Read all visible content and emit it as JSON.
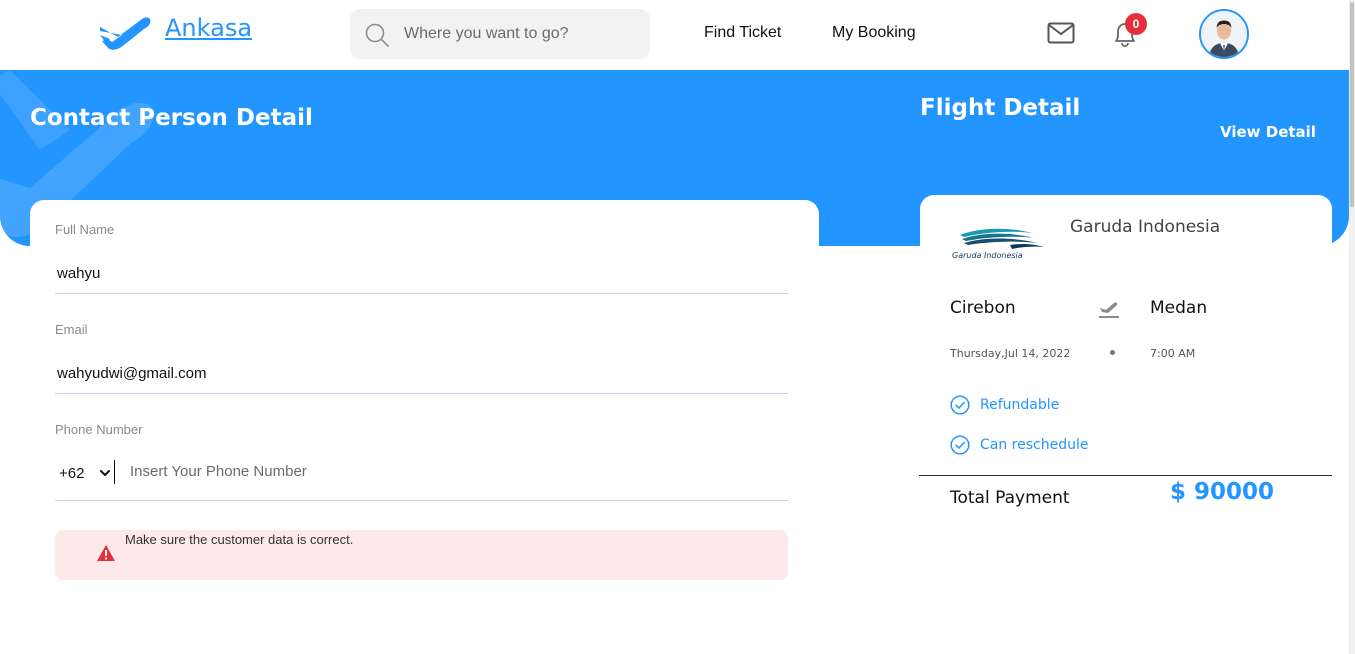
{
  "brand": {
    "name": "Ankasa",
    "logo_icon": "plane-logo-icon",
    "accent_color": "#2395ff"
  },
  "search": {
    "placeholder": "Where you want to go?",
    "icon": "search-icon"
  },
  "nav": {
    "find_ticket": "Find Ticket",
    "my_booking": "My Booking"
  },
  "header_icons": {
    "mail": "mail-icon",
    "notification": "bell-icon",
    "notification_count": "0",
    "badge_color": "#e62e3d"
  },
  "contact": {
    "title": "Contact Person Detail",
    "full_name_label": "Full Name",
    "full_name_value": "wahyu",
    "email_label": "Email",
    "email_value": "wahyudwi@gmail.com",
    "phone_label": "Phone Number",
    "phone_code": "+62",
    "phone_placeholder": "Insert Your Phone Number",
    "warning_text": "Make sure the customer data is correct.",
    "warning_icon": "warning-icon"
  },
  "flight": {
    "title": "Flight Detail",
    "view_detail": "View Detail",
    "airline_logo_text": "Garuda Indonesia",
    "airline_name": "Garuda Indonesia",
    "origin": "Cirebon",
    "destination": "Medan",
    "date": "Thursday,Jul 14, 2022",
    "time": "7:00 AM",
    "features": [
      "Refundable",
      "Can reschedule"
    ],
    "total_label": "Total Payment",
    "total_value": "$ 90000"
  }
}
